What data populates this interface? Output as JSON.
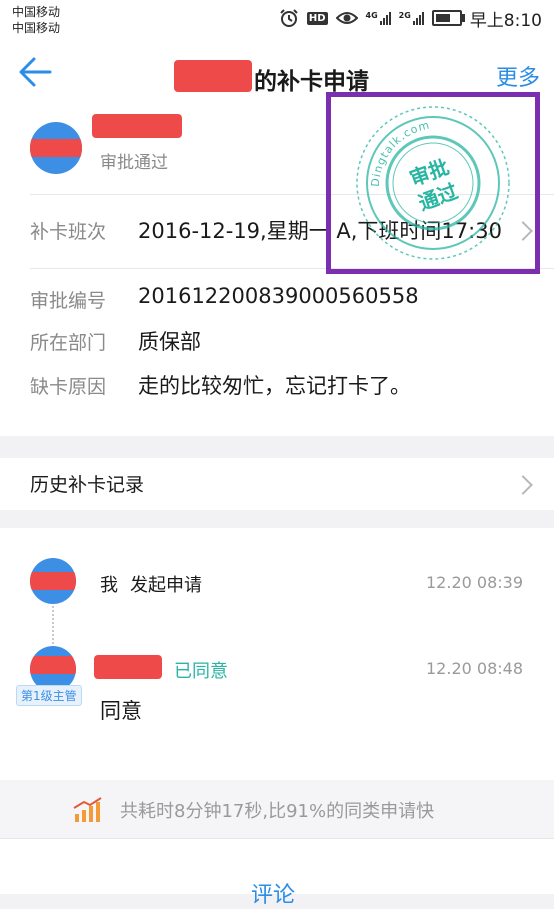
{
  "status_bar": {
    "carrier_1": "中国移动",
    "carrier_2": "中国移动",
    "hd_label": "HD",
    "net_1": "4G",
    "net_2": "2G",
    "time": "早上8:10",
    "battery_percent": 80,
    "icons": [
      "alarm-icon",
      "hd-icon",
      "eye-icon",
      "signal-icon",
      "battery-icon"
    ]
  },
  "header": {
    "title_suffix": "的补卡申请",
    "more_label": "更多",
    "back_icon": "back-arrow-icon"
  },
  "applicant": {
    "status": "审批通过"
  },
  "stamp": {
    "text_line1": "审批",
    "text_line2": "通过",
    "ring_text": "Dingtalk.com",
    "color": "#28b5a2"
  },
  "fields": [
    {
      "label": "补卡班次",
      "value": "2016-12-19,星期一 A,下班时间17:30"
    },
    {
      "label": "审批编号",
      "value": "2016122008390005605​58"
    },
    {
      "label": "所在部门",
      "value": "质保部"
    },
    {
      "label": "缺卡原因",
      "value": "走的比较匆忙，忘记打卡了。"
    }
  ],
  "history": {
    "label": "历史补卡记录"
  },
  "timeline": [
    {
      "actor": "我",
      "action": "发起申请",
      "time": "12.20 08:39"
    },
    {
      "badge": "第1级主管",
      "status": "已同意",
      "time": "12.20 08:48",
      "comment": "同意"
    }
  ],
  "summary": {
    "text": "共耗时8分钟17秒,比91%的同类申请快"
  },
  "footer": {
    "comment_label": "评论"
  },
  "colors": {
    "accent": "#2b8de6",
    "approved": "#28b5a2",
    "highlight_border": "#7b2fb0",
    "redaction": "#ee4a4a"
  }
}
